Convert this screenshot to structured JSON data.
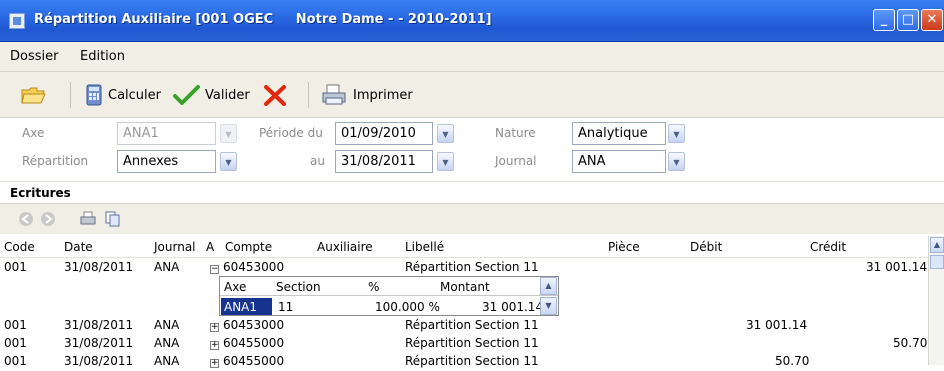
{
  "window": {
    "title": "Répartition Auxiliaire [001 OGEC     Notre Dame - - 2010-2011]",
    "min_glyph": "_",
    "max_glyph": "□",
    "close_glyph": "✕"
  },
  "menu": [
    "Dossier",
    "Edition"
  ],
  "toolbar": {
    "calculer": "Calculer",
    "valider": "Valider",
    "imprimer": "Imprimer"
  },
  "filters": {
    "axe_label": "Axe",
    "axe_value": "ANA1",
    "repartition_label": "Répartition",
    "repartition_value": "Annexes",
    "periode_du_label": "Période du",
    "periode_du_value": "01/09/2010",
    "au_label": "au",
    "au_value": "31/08/2011",
    "nature_label": "Nature",
    "nature_value": "Analytique",
    "journal_label": "Journal",
    "journal_value": "ANA"
  },
  "ecritures": {
    "title": "Ecritures"
  },
  "grid": {
    "headers": [
      "Code",
      "Date",
      "Journal",
      "A",
      "Compte",
      "Auxiliaire",
      "Libellé",
      "Pièce",
      "Débit",
      "Crédit"
    ],
    "rows": [
      {
        "code": "001",
        "date": "31/08/2011",
        "journal": "ANA",
        "expander": "−",
        "compte": "60453000",
        "libelle": "Répartition Section 11",
        "debit": "",
        "credit": "31 001.14"
      },
      {
        "code": "001",
        "date": "31/08/2011",
        "journal": "ANA",
        "expander": "+",
        "compte": "60453000",
        "libelle": "Répartition Section 11",
        "debit": "31 001.14",
        "credit": ""
      },
      {
        "code": "001",
        "date": "31/08/2011",
        "journal": "ANA",
        "expander": "+",
        "compte": "60455000",
        "libelle": "Répartition Section 11",
        "debit": "",
        "credit": "50.70"
      },
      {
        "code": "001",
        "date": "31/08/2011",
        "journal": "ANA",
        "expander": "+",
        "compte": "60455000",
        "libelle": "Répartition Section 11",
        "debit": "50.70",
        "credit": ""
      }
    ]
  },
  "subtable": {
    "headers": [
      "Axe",
      "Section",
      "%",
      "Montant"
    ],
    "row": {
      "axe": "ANA1",
      "section": "11",
      "pct": "100.000 %",
      "montant": "31 001.14"
    }
  },
  "glyphs": {
    "dropdown": "▼",
    "scroll_up": "▲",
    "scroll_down": "▼",
    "back": "◀",
    "forward": "▶"
  },
  "colors": {
    "titlebar": "#2b6de6",
    "toolbar_bg": "#f1efe5",
    "selection": "#16348f"
  }
}
